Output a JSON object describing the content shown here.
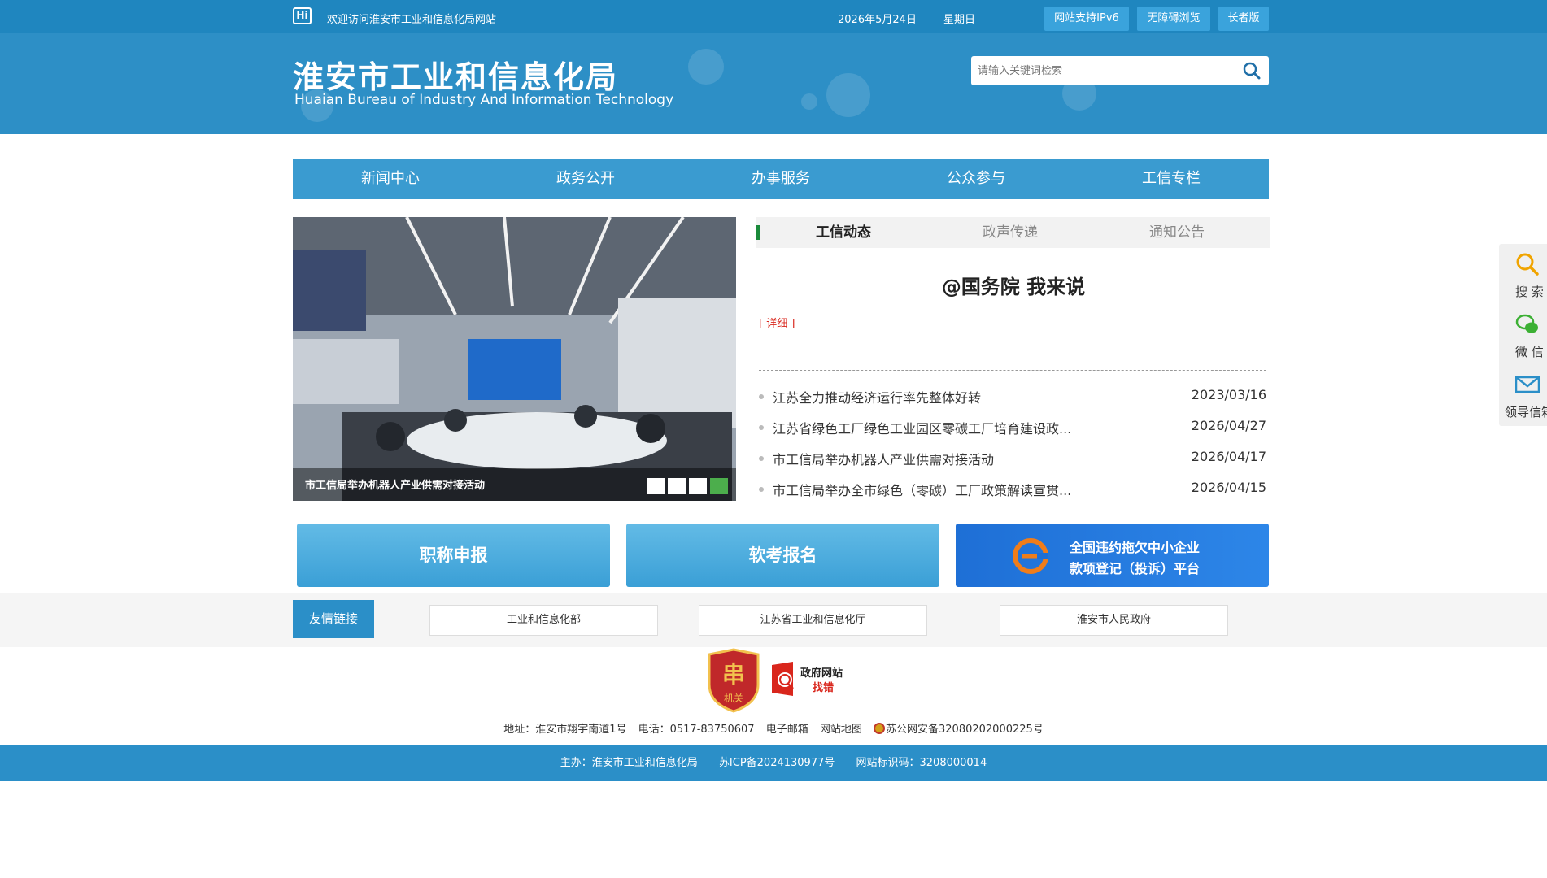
{
  "topbar": {
    "logo_text": "Hi",
    "welcome": "欢迎访问淮安市工业和信息化局网站",
    "date": "2026年5月24日",
    "weekday": "星期日",
    "buttons": [
      "网站支持IPv6",
      "无障碍浏览",
      "长者版"
    ]
  },
  "header": {
    "title_cn": "淮安市工业和信息化局",
    "title_en": "Huaian Bureau of Industry And Information Technology",
    "search_placeholder": "请输入关键词检索"
  },
  "nav": [
    "新闻中心",
    "政务公开",
    "办事服务",
    "公众参与",
    "工信专栏"
  ],
  "slider": {
    "caption": "市工信局举办机器人产业供需对接活动",
    "active_dot": 4
  },
  "news": {
    "tabs": [
      "工信动态",
      "政声传递",
      "通知公告"
    ],
    "active_tab": "工信动态",
    "headline": "@国务院 我来说",
    "detail_link": "[ 详细 ]",
    "items": [
      {
        "title": "江苏全力推动经济运行率先整体好转",
        "date": "2023/03/16"
      },
      {
        "title": "江苏省绿色工厂绿色工业园区零碳工厂培育建设政...",
        "date": "2026/04/27"
      },
      {
        "title": "市工信局举办机器人产业供需对接活动",
        "date": "2026/04/17"
      },
      {
        "title": "市工信局举办全市绿色（零碳）工厂政策解读宣贯...",
        "date": "2026/04/15"
      }
    ]
  },
  "quick_links": {
    "q1": "职称申报",
    "q2": "软考报名",
    "q3_line1": "全国违约拖欠中小企业",
    "q3_line2": "款项登记（投诉）平台"
  },
  "friend_links": {
    "label": "友情链接",
    "items": [
      "工业和信息化部",
      "江苏省工业和信息化厅",
      "淮安市人民政府"
    ]
  },
  "footer": {
    "badge_text": "机关",
    "zhaocuo_line1": "政府网站",
    "zhaocuo_line2": "找错",
    "address": "地址：淮安市翔宇南道1号",
    "phone": "电话：0517-83750607",
    "email": "电子邮箱",
    "sitemap": "网站地图",
    "police": "苏公网安备32080202000225号",
    "host": "主办：淮安市工业和信息化局",
    "icp": "苏ICP备2024130977号",
    "site_code": "网站标识码：3208000014"
  },
  "side": [
    "搜 索",
    "微 信",
    "领导信箱"
  ],
  "colors": {
    "brand_blue": "#2d8fc6",
    "topbar_blue": "#1f86bf",
    "accent_red": "#d9261c",
    "accent_green": "#1a8a3a"
  }
}
